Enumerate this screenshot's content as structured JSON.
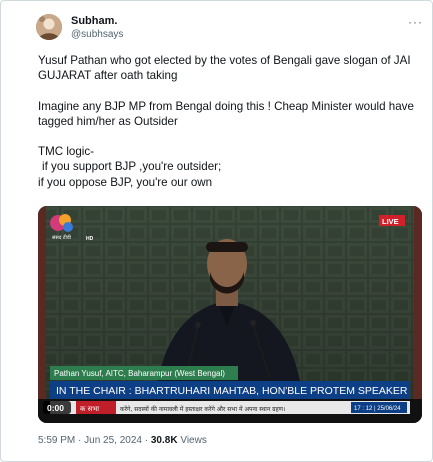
{
  "tweet": {
    "author_name": "Subham.",
    "author_handle": "@subhsays",
    "more_icon": "more-dots-icon",
    "lines": [
      "Yusuf Pathan who got elected by the votes of Bengali gave slogan of JAI",
      "GUJARAT after oath taking",
      "",
      "Imagine any BJP MP from Bengal doing this ! Cheap Minister would have",
      "tagged him/her as Outsider",
      "",
      "TMC logic-",
      " if you support BJP ,you're outsider;",
      "if you oppose BJP, you're our own"
    ],
    "time": "5:59 PM",
    "separator": " · ",
    "date": "Jun 25, 2024",
    "views_count": "30.8K",
    "views_label": "Views"
  },
  "video": {
    "channel_logo_text": "संसद टीवी",
    "hd_badge": "HD",
    "live_badge": "LIVE",
    "caption_name": "Pathan Yusuf, AITC, Baharampur (West Bengal)",
    "chair_banner": "IN THE CHAIR : BHARTRUHARI MAHTAB, HON'BLE PROTEM SPEAKER",
    "timer": "0:00",
    "ticker_prefix": "क सभा",
    "ticker_text": "करेंगे, सदस्यों की नामावली में हस्ताक्षर करेंगे और सभा में अपना स्थान ग्रहण।",
    "clock": "17 : 12 | 25/06/24",
    "colors": {
      "live": "#d0202a",
      "caption_bg": "#2e7d4f",
      "banner_bg": "#0d3f86",
      "ticker_bg": "#e8e8e8"
    }
  }
}
